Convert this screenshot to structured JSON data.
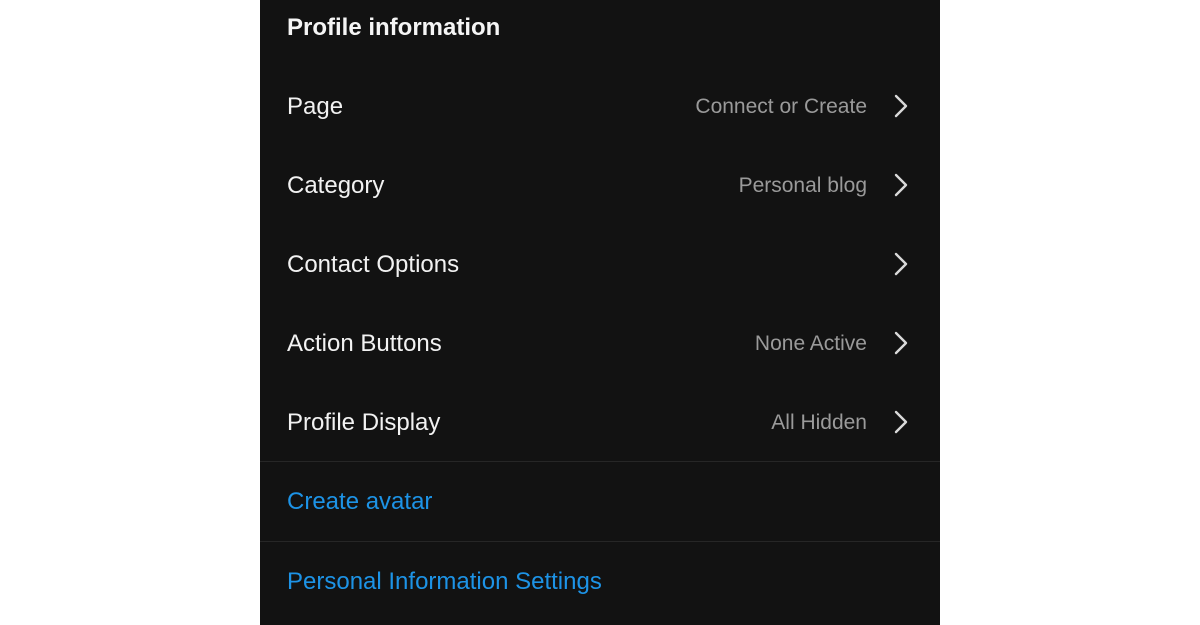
{
  "section": {
    "title": "Profile information"
  },
  "rows": [
    {
      "label": "Page",
      "value": "Connect or Create",
      "icon": "chevron-right-icon"
    },
    {
      "label": "Category",
      "value": "Personal blog",
      "icon": "chevron-right-icon"
    },
    {
      "label": "Contact Options",
      "value": "",
      "icon": "chevron-right-icon"
    },
    {
      "label": "Action Buttons",
      "value": "None Active",
      "icon": "chevron-right-icon"
    },
    {
      "label": "Profile Display",
      "value": "All Hidden",
      "icon": "chevron-right-icon"
    }
  ],
  "links": {
    "create_avatar": "Create avatar",
    "personal_information_settings": "Personal Information Settings"
  },
  "colors": {
    "panel_background": "#121212",
    "label_text": "#f2f2f2",
    "value_text": "#9a9a9a",
    "link_text": "#1d93e6",
    "divider": "#262626"
  }
}
